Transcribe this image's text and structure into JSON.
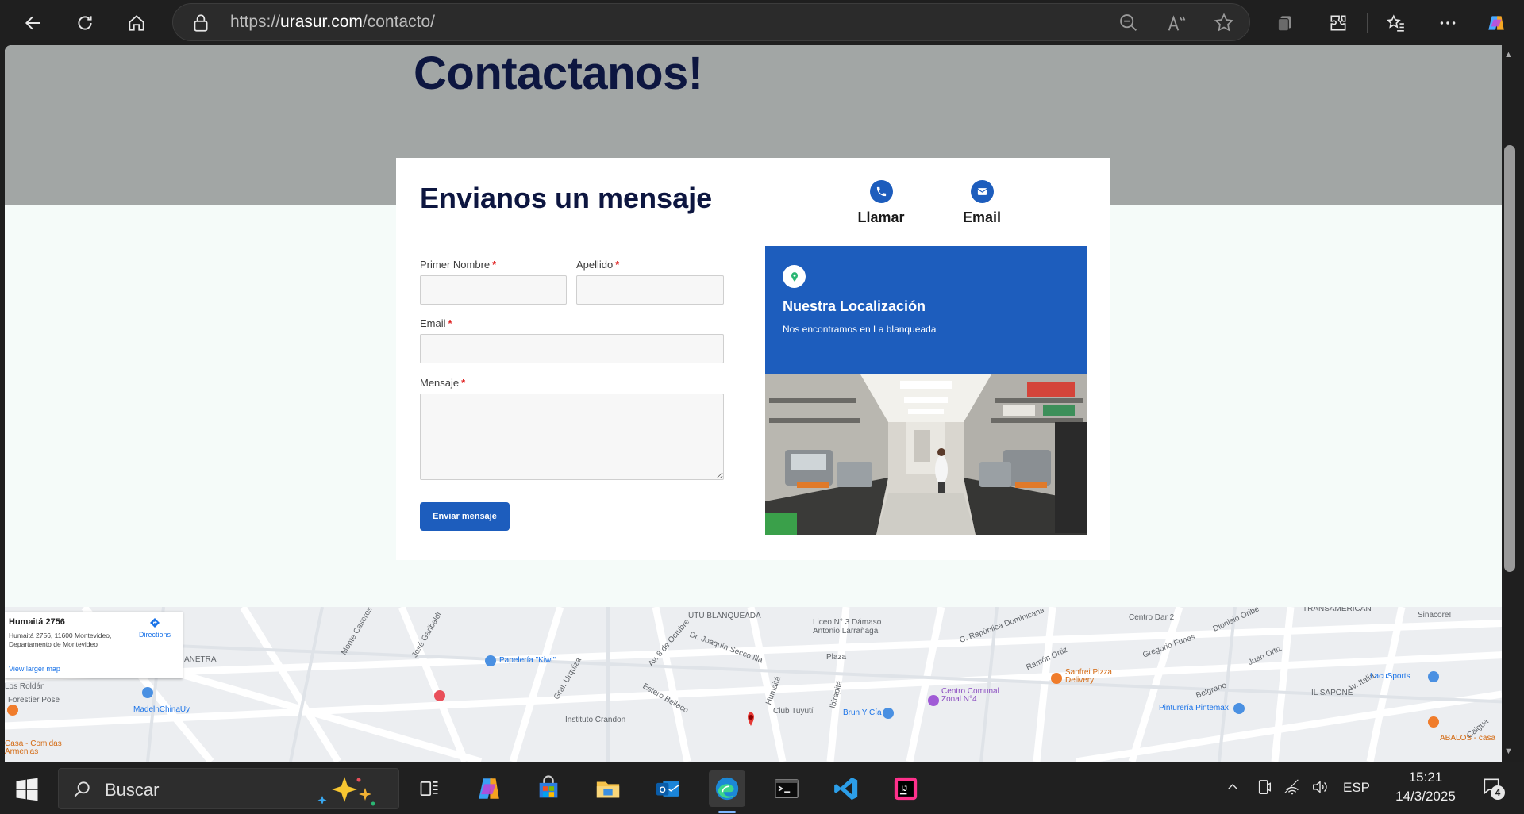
{
  "browser": {
    "url_prefix": "https://",
    "url_domain": "urasur.com",
    "url_path": "/contacto/"
  },
  "page": {
    "hero_title": "Contactanos!",
    "form": {
      "heading": "Envianos un mensaje",
      "first_name_label": "Primer Nombre",
      "last_name_label": "Apellido",
      "email_label": "Email",
      "message_label": "Mensaje",
      "required_mark": "*",
      "submit_label": "Enviar mensaje"
    },
    "contact_options": {
      "call_label": "Llamar",
      "email_label": "Email"
    },
    "location": {
      "title": "Nuestra Localización",
      "subtitle": "Nos encontramos en La blanqueada"
    },
    "map": {
      "place_name": "Humaitá 2756",
      "place_address": "Humaitá 2756, 11600 Montevideo, Departamento de Montevideo",
      "directions_label": "Directions",
      "larger_map_label": "View larger map",
      "streets": [
        "UTU BLANQUEADA",
        "Liceo N° 3 Dámaso Antonio Larrañaga",
        "Plaza",
        "Dr. Joaquín Secco Illa",
        "Av. 8 de Octubre",
        "Estero Bellaco",
        "Centro Dar 2",
        "Dionisio Oribe",
        "Gregorio Funes",
        "Juan Ortiz",
        "Ramón Ortiz",
        "Av. Italia",
        "Belgrano",
        "IL SAPONE",
        "Caiguá",
        "Centro Comunal Zonal N°4",
        "Club Tuyutí",
        "Instituto Crandon",
        "MadelnChinaUy",
        "Papelería \"Kiwi\"",
        "Sanfrei Pizza Delivery",
        "Pinturería Pintemax",
        "LacuSports",
        "Brun Y Cía",
        "ABALOS - casa",
        "Humaitá",
        "Ibirapitá",
        "ANETRA",
        "Gral. Urquiza",
        "José Garibaldi",
        "Monte Caseros",
        "Sinacore!",
        "TRANSAMERICAN",
        "C. República Dominicana",
        "Forestier Pose",
        "Los Roldán",
        "Casa - Comidas Armenias"
      ]
    }
  },
  "taskbar": {
    "search_placeholder": "Buscar",
    "language": "ESP",
    "time": "15:21",
    "date": "14/3/2025",
    "notifications": "4"
  }
}
